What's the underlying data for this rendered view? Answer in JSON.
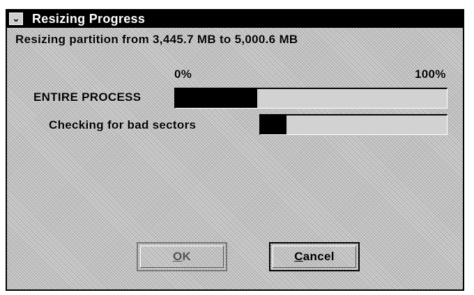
{
  "window": {
    "title": "Resizing Progress",
    "system_menu_glyph": "⌄"
  },
  "status": {
    "message": "Resizing partition from 3,445.7 MB to 5,000.6 MB"
  },
  "progress": {
    "scale_min_label": "0%",
    "scale_max_label": "100%",
    "entire": {
      "label": "ENTIRE PROCESS",
      "fraction": 0.3
    },
    "step": {
      "label": "Checking for bad sectors",
      "fraction": 0.14
    }
  },
  "buttons": {
    "ok": {
      "mnemonic": "O",
      "rest": "K",
      "enabled": false
    },
    "cancel": {
      "mnemonic": "C",
      "rest": "ancel",
      "enabled": true
    }
  }
}
